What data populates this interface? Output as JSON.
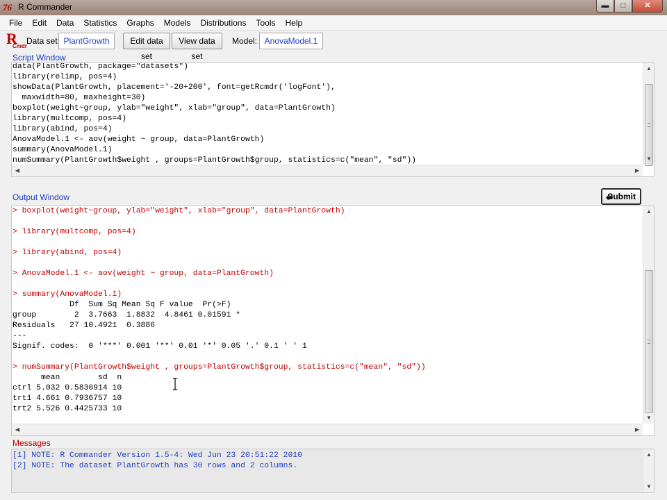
{
  "window": {
    "title": "R Commander",
    "app_icon": "76"
  },
  "menu": [
    "File",
    "Edit",
    "Data",
    "Statistics",
    "Graphs",
    "Models",
    "Distributions",
    "Tools",
    "Help"
  ],
  "toolbar": {
    "logo_r": "R",
    "logo_sub": "Cmdr",
    "dataset_label": "Data set:",
    "dataset_value": "PlantGrowth",
    "edit_button": "Edit data set",
    "view_button": "View data set",
    "model_label": "Model:",
    "model_value": "AnovaModel.1"
  },
  "script_window": {
    "label": "Script Window",
    "lines": [
      "data(PlantGrowth, package=\"datasets\")",
      "library(relimp, pos=4)",
      "showData(PlantGrowth, placement='-20+200', font=getRcmdr('logFont'),",
      "  maxwidth=80, maxheight=30)",
      "boxplot(weight~group, ylab=\"weight\", xlab=\"group\", data=PlantGrowth)",
      "library(multcomp, pos=4)",
      "library(abind, pos=4)",
      "AnovaModel.1 <- aov(weight ~ group, data=PlantGrowth)",
      "summary(AnovaModel.1)",
      "numSummary(PlantGrowth$weight , groups=PlantGrowth$group, statistics=c(\"mean\", \"sd\"))"
    ]
  },
  "submit_button": "Submit",
  "output_window": {
    "label": "Output Window",
    "lines": [
      {
        "text": "> boxplot(weight~group, ylab=\"weight\", xlab=\"group\", data=PlantGrowth)",
        "kind": "cmd"
      },
      {
        "text": "",
        "kind": "out"
      },
      {
        "text": "> library(multcomp, pos=4)",
        "kind": "cmd"
      },
      {
        "text": "",
        "kind": "out"
      },
      {
        "text": "> library(abind, pos=4)",
        "kind": "cmd"
      },
      {
        "text": "",
        "kind": "out"
      },
      {
        "text": "> AnovaModel.1 <- aov(weight ~ group, data=PlantGrowth)",
        "kind": "cmd"
      },
      {
        "text": "",
        "kind": "out"
      },
      {
        "text": "> summary(AnovaModel.1)",
        "kind": "cmd"
      },
      {
        "text": "            Df  Sum Sq Mean Sq F value  Pr(>F)",
        "kind": "out"
      },
      {
        "text": "group        2  3.7663  1.8832  4.8461 0.01591 *",
        "kind": "out"
      },
      {
        "text": "Residuals   27 10.4921  0.3886",
        "kind": "out"
      },
      {
        "text": "---",
        "kind": "out"
      },
      {
        "text": "Signif. codes:  0 '***' 0.001 '**' 0.01 '*' 0.05 '.' 0.1 ' ' 1",
        "kind": "out"
      },
      {
        "text": "",
        "kind": "out"
      },
      {
        "text": "> numSummary(PlantGrowth$weight , groups=PlantGrowth$group, statistics=c(\"mean\", \"sd\"))",
        "kind": "cmd"
      },
      {
        "text": "      mean        sd  n",
        "kind": "out"
      },
      {
        "text": "ctrl 5.032 0.5830914 10",
        "kind": "out"
      },
      {
        "text": "trt1 4.661 0.7936757 10",
        "kind": "out"
      },
      {
        "text": "trt2 5.526 0.4425733 10",
        "kind": "out"
      }
    ]
  },
  "messages": {
    "label": "Messages",
    "lines": [
      "[1] NOTE: R Commander Version 1.5-4: Wed Jun 23 20:51:22 2010",
      "[2] NOTE: The dataset PlantGrowth has 30 rows and 2 columns."
    ]
  }
}
